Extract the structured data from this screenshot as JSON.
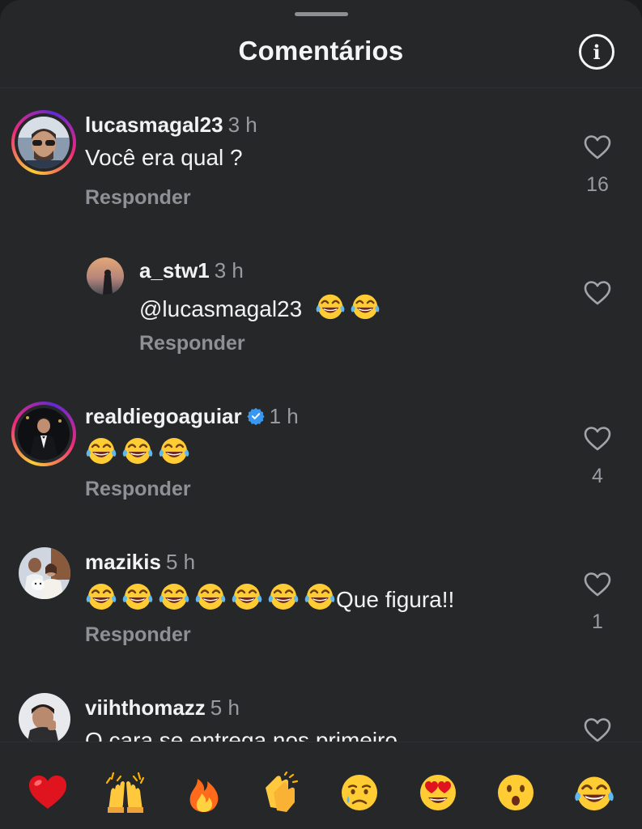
{
  "header": {
    "title": "Comentários",
    "info_icon_glyph": "i"
  },
  "comments": [
    {
      "username": "lucasmagal23",
      "time": "3 h",
      "text": "Você era qual ?",
      "reply_label": "Responder",
      "likes": "16"
    },
    {
      "username": "a_stw1",
      "time": "3 h",
      "text": "@lucasmagal23",
      "reply_label": "Responder",
      "likes": ""
    },
    {
      "username": "realdiegoaguiar",
      "time": "1 h",
      "text": "",
      "reply_label": "Responder",
      "likes": "4",
      "verified": true
    },
    {
      "username": "mazikis",
      "time": "5 h",
      "text": "Que figura!!",
      "reply_label": "Responder",
      "likes": "1"
    },
    {
      "username": "viihthomazz",
      "time": "5 h",
      "text": "O cara se entrega nos primeiro",
      "reply_label": "",
      "likes": ""
    }
  ],
  "reactions": [
    "red-heart",
    "raising-hands",
    "fire",
    "clapping-hands",
    "crying-face",
    "heart-eyes",
    "astonished-face",
    "tears-of-joy"
  ],
  "colors": {
    "background": "#262729",
    "text": "#f2f2f2",
    "muted": "#9a9ba0",
    "verified": "#3897f0"
  }
}
